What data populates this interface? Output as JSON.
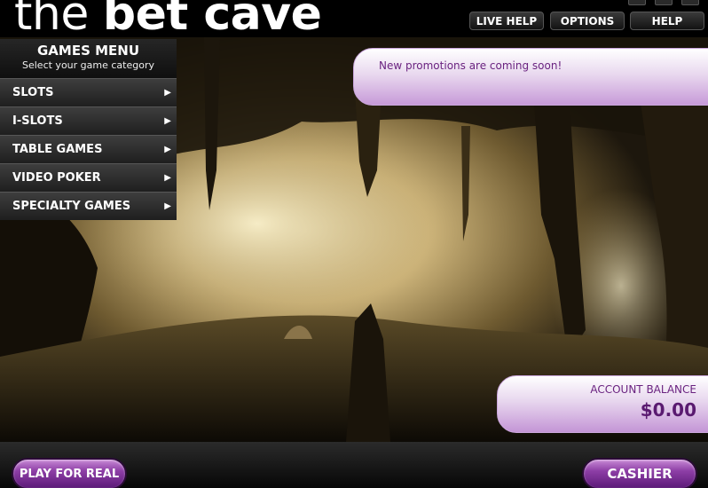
{
  "header": {
    "logo_light": "the ",
    "logo_bold": "bet cave",
    "buttons": {
      "live_help": "LIVE HELP",
      "options": "OPTIONS",
      "help": "HELP"
    }
  },
  "menu": {
    "title": "GAMES MENU",
    "subtitle": "Select your game category",
    "items": [
      {
        "label": "SLOTS"
      },
      {
        "label": "I-SLOTS"
      },
      {
        "label": "TABLE GAMES"
      },
      {
        "label": "VIDEO POKER"
      },
      {
        "label": "SPECIALTY GAMES"
      }
    ],
    "arrow_icon": "arrow-right-icon"
  },
  "promo": {
    "text": "New promotions are coming soon!"
  },
  "balance": {
    "label": "ACCOUNT BALANCE",
    "value": "$0.00"
  },
  "footer": {
    "play_for_real": "PLAY FOR REAL",
    "cashier": "CASHIER"
  },
  "colors": {
    "accent_purple": "#8d3ea6",
    "text_purple": "#6a2380",
    "background": "#000000"
  }
}
